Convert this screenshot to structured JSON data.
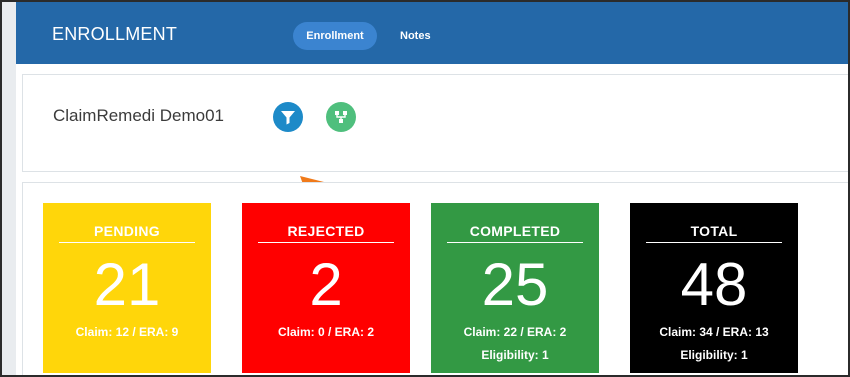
{
  "header": {
    "title": "ENROLLMENT",
    "tabs": [
      {
        "label": "Enrollment",
        "active": true
      },
      {
        "label": "Notes",
        "active": false
      }
    ]
  },
  "client": {
    "name": "ClaimRemedi Demo01",
    "buttons": [
      {
        "icon": "filter-icon",
        "color": "#1d8ac8"
      },
      {
        "icon": "org-tree-icon",
        "color": "#4fbf7d"
      }
    ]
  },
  "annotation": {
    "icon": "arrow-pointer-icon",
    "color": "#f07a1a"
  },
  "stats": [
    {
      "title": "PENDING",
      "value": "21",
      "sub": "Claim: 12 / ERA: 9",
      "sub2": "",
      "color": "#ffd60a"
    },
    {
      "title": "REJECTED",
      "value": "2",
      "sub": "Claim: 0 / ERA: 2",
      "sub2": "",
      "color": "#ff0000"
    },
    {
      "title": "COMPLETED",
      "value": "25",
      "sub": "Claim: 22 / ERA: 2",
      "sub2": "Eligibility: 1",
      "color": "#339944"
    },
    {
      "title": "TOTAL",
      "value": "48",
      "sub": "Claim: 34 / ERA: 13",
      "sub2": "Eligibility: 1",
      "color": "#000000"
    }
  ]
}
